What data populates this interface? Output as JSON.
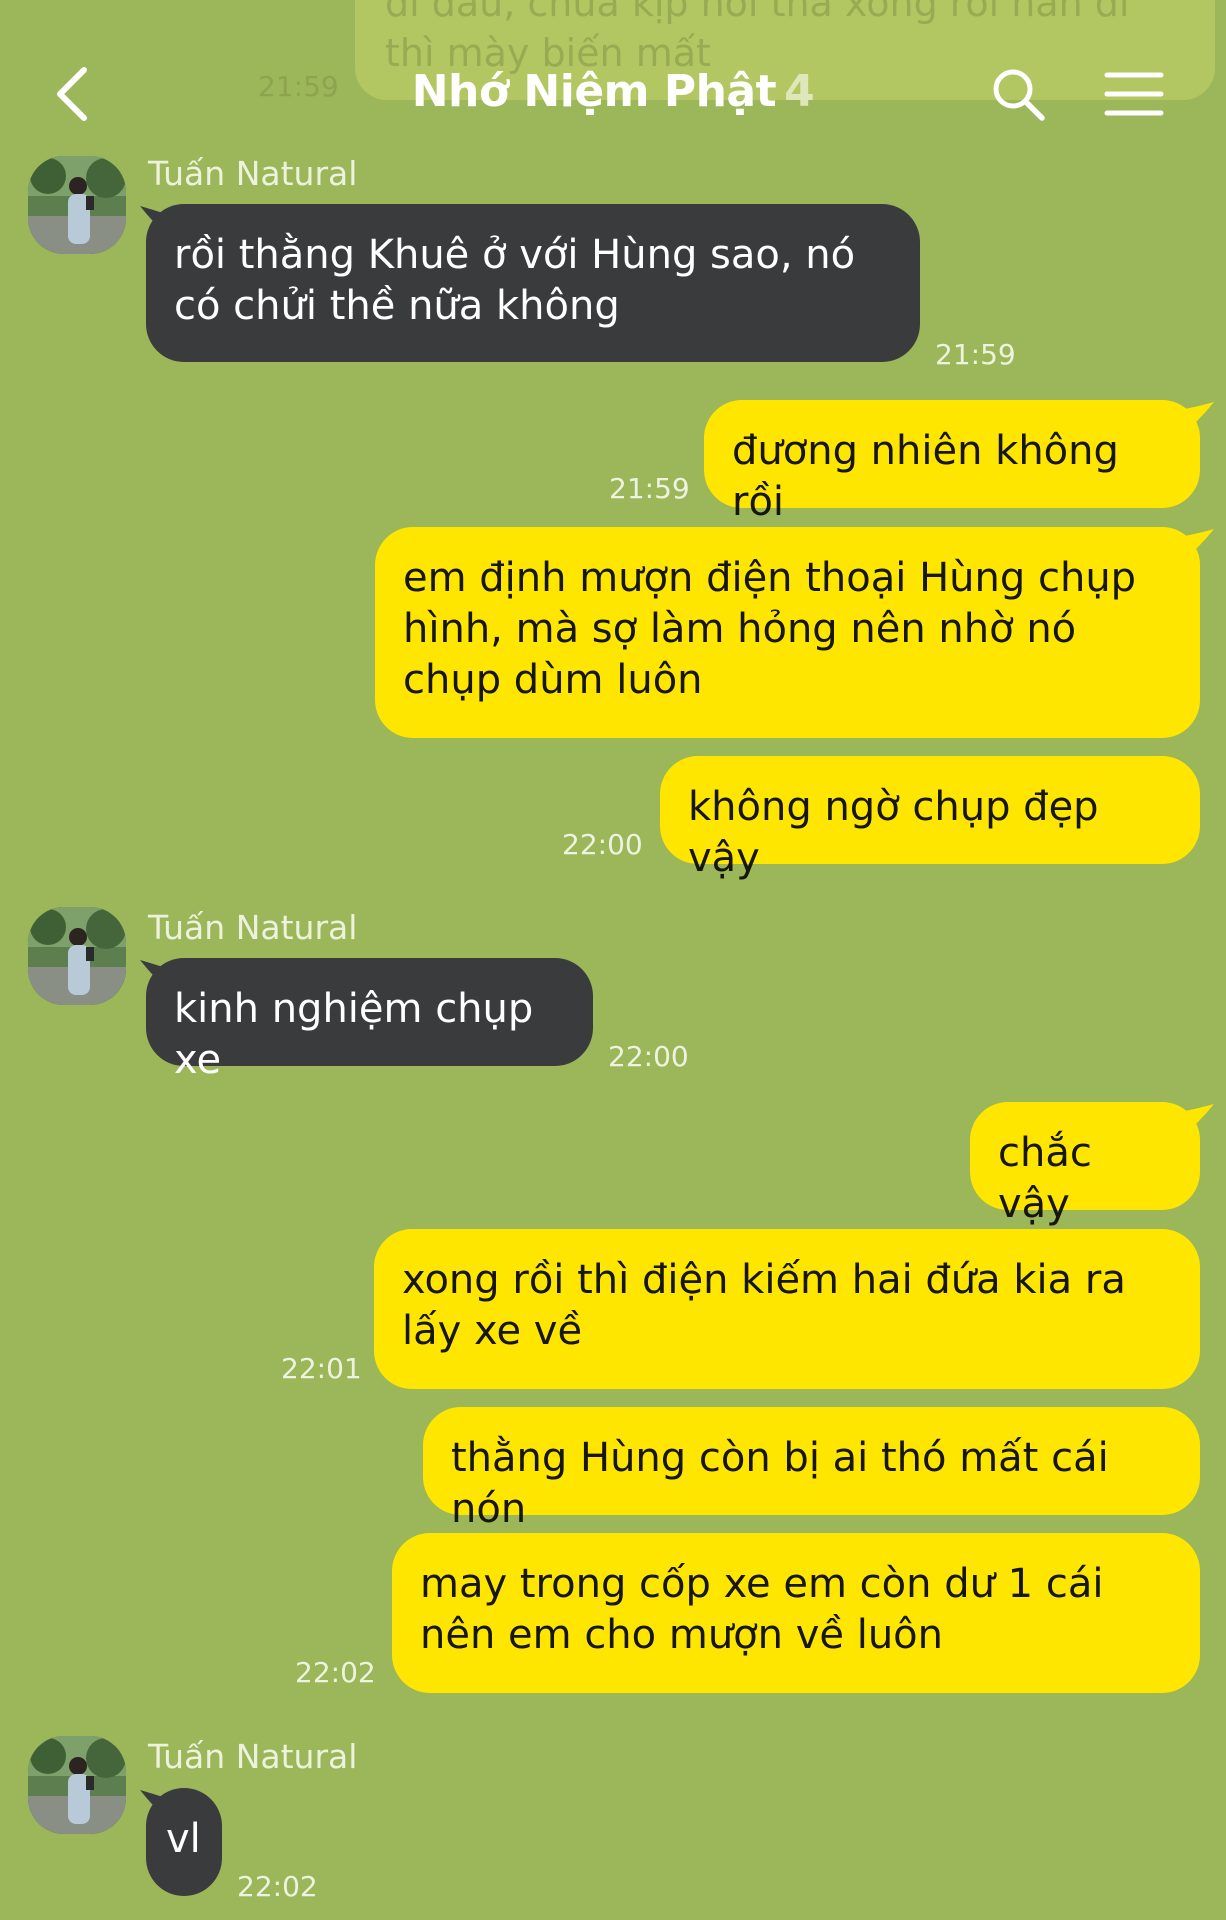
{
  "header": {
    "title": "Nhớ Niệm Phật",
    "member_count": "4",
    "back_icon": "chevron-left-icon",
    "search_icon": "search-icon",
    "menu_icon": "hamburger-menu-icon"
  },
  "previous_message": {
    "text": "đi đâu, chưa kịp nói tha xong rồi hắn đi thì mày biến mất",
    "time": "21:59"
  },
  "colors": {
    "background": "#9cb65a",
    "incoming_bubble": "#3a3b3d",
    "outgoing_bubble": "#ffe600"
  },
  "messages": [
    {
      "id": "m1",
      "sender": "Tuấn Natural",
      "text": "rồi thằng Khuê ở với Hùng sao, nó có chửi thề nữa không",
      "time": "21:59"
    },
    {
      "id": "m2",
      "text": "đương nhiên không rồi",
      "time": "21:59"
    },
    {
      "id": "m3",
      "text": "em định mượn điện thoại Hùng chụp hình, mà sợ làm hỏng nên nhờ nó chụp dùm luôn",
      "time": ""
    },
    {
      "id": "m4",
      "text": "không ngờ chụp đẹp vậy",
      "time": "22:00"
    },
    {
      "id": "m5",
      "sender": "Tuấn Natural",
      "text": "kinh nghiệm chụp xe",
      "time": "22:00"
    },
    {
      "id": "m6",
      "text": "chắc vậy",
      "time": ""
    },
    {
      "id": "m7",
      "text": "xong rồi thì điện kiếm hai đứa kia ra lấy xe về",
      "time": "22:01"
    },
    {
      "id": "m8",
      "text": "thằng Hùng còn bị ai thó mất cái nón",
      "time": ""
    },
    {
      "id": "m9",
      "text": "may trong cốp xe em còn dư 1 cái nên em cho mượn về luôn",
      "time": "22:02"
    },
    {
      "id": "m10",
      "sender": "Tuấn Natural",
      "text": "vl",
      "time": "22:02"
    }
  ]
}
